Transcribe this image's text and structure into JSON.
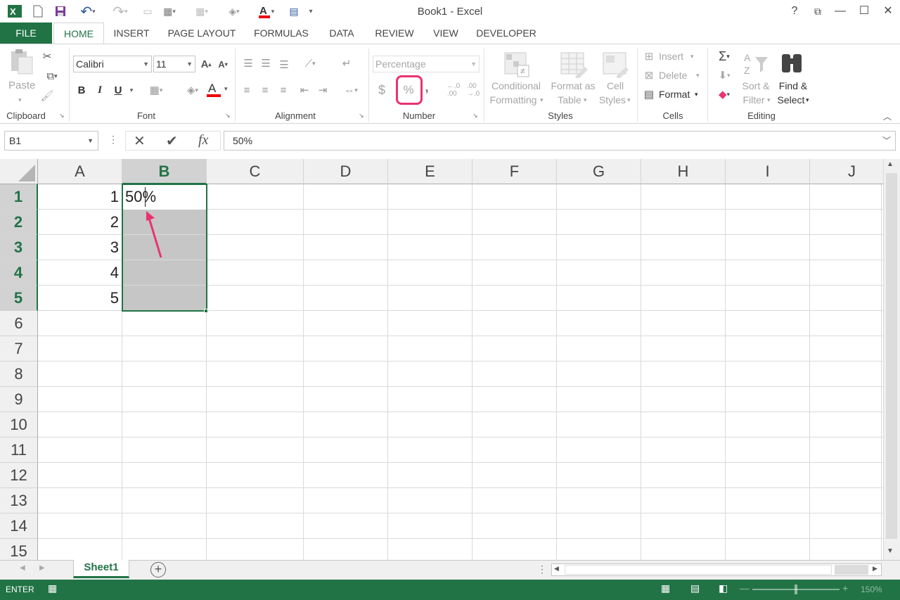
{
  "window": {
    "title": "Book1 - Excel"
  },
  "window_controls": {
    "help": "?",
    "restore_ribbon": "⧉",
    "minimize": "—",
    "maximize": "☐",
    "close": "✕"
  },
  "tabs": [
    {
      "label": "FILE"
    },
    {
      "label": "HOME"
    },
    {
      "label": "INSERT"
    },
    {
      "label": "PAGE LAYOUT"
    },
    {
      "label": "FORMULAS"
    },
    {
      "label": "DATA"
    },
    {
      "label": "REVIEW"
    },
    {
      "label": "VIEW"
    },
    {
      "label": "DEVELOPER"
    }
  ],
  "ribbon": {
    "clipboard": {
      "label": "Clipboard",
      "paste": "Paste"
    },
    "font": {
      "label": "Font",
      "name": "Calibri",
      "size": "11",
      "bold": "B",
      "italic": "I",
      "underline": "U"
    },
    "alignment": {
      "label": "Alignment"
    },
    "number": {
      "label": "Number",
      "format": "Percentage",
      "currency": "$",
      "percent": "%",
      "comma": ","
    },
    "styles": {
      "label": "Styles",
      "conditional_1": "Conditional",
      "conditional_2": "Formatting",
      "format_table_1": "Format as",
      "format_table_2": "Table",
      "cell_styles_1": "Cell",
      "cell_styles_2": "Styles"
    },
    "cells": {
      "label": "Cells",
      "insert": "Insert",
      "delete": "Delete",
      "format": "Format"
    },
    "editing": {
      "label": "Editing",
      "sort_1": "Sort &",
      "sort_2": "Filter",
      "find_1": "Find &",
      "find_2": "Select"
    }
  },
  "formula_bar": {
    "name_box": "B1",
    "cancel": "✕",
    "enter": "✔",
    "fx": "fx",
    "value": "50%"
  },
  "columns": [
    "A",
    "B",
    "C",
    "D",
    "E",
    "F",
    "G",
    "H",
    "I",
    "J"
  ],
  "rows": [
    "1",
    "2",
    "3",
    "4",
    "5",
    "6",
    "7",
    "8",
    "9",
    "10",
    "11",
    "12",
    "13",
    "14",
    "15"
  ],
  "cells": {
    "A1": "1",
    "A2": "2",
    "A3": "3",
    "A4": "4",
    "A5": "5",
    "B1": "50%"
  },
  "sheet_tabs": {
    "sheet1": "Sheet1"
  },
  "status": {
    "mode": "ENTER",
    "zoom": "150%"
  },
  "colors": {
    "accent": "#217346",
    "highlight": "#e8336e",
    "selection": "#c6c6c6"
  }
}
